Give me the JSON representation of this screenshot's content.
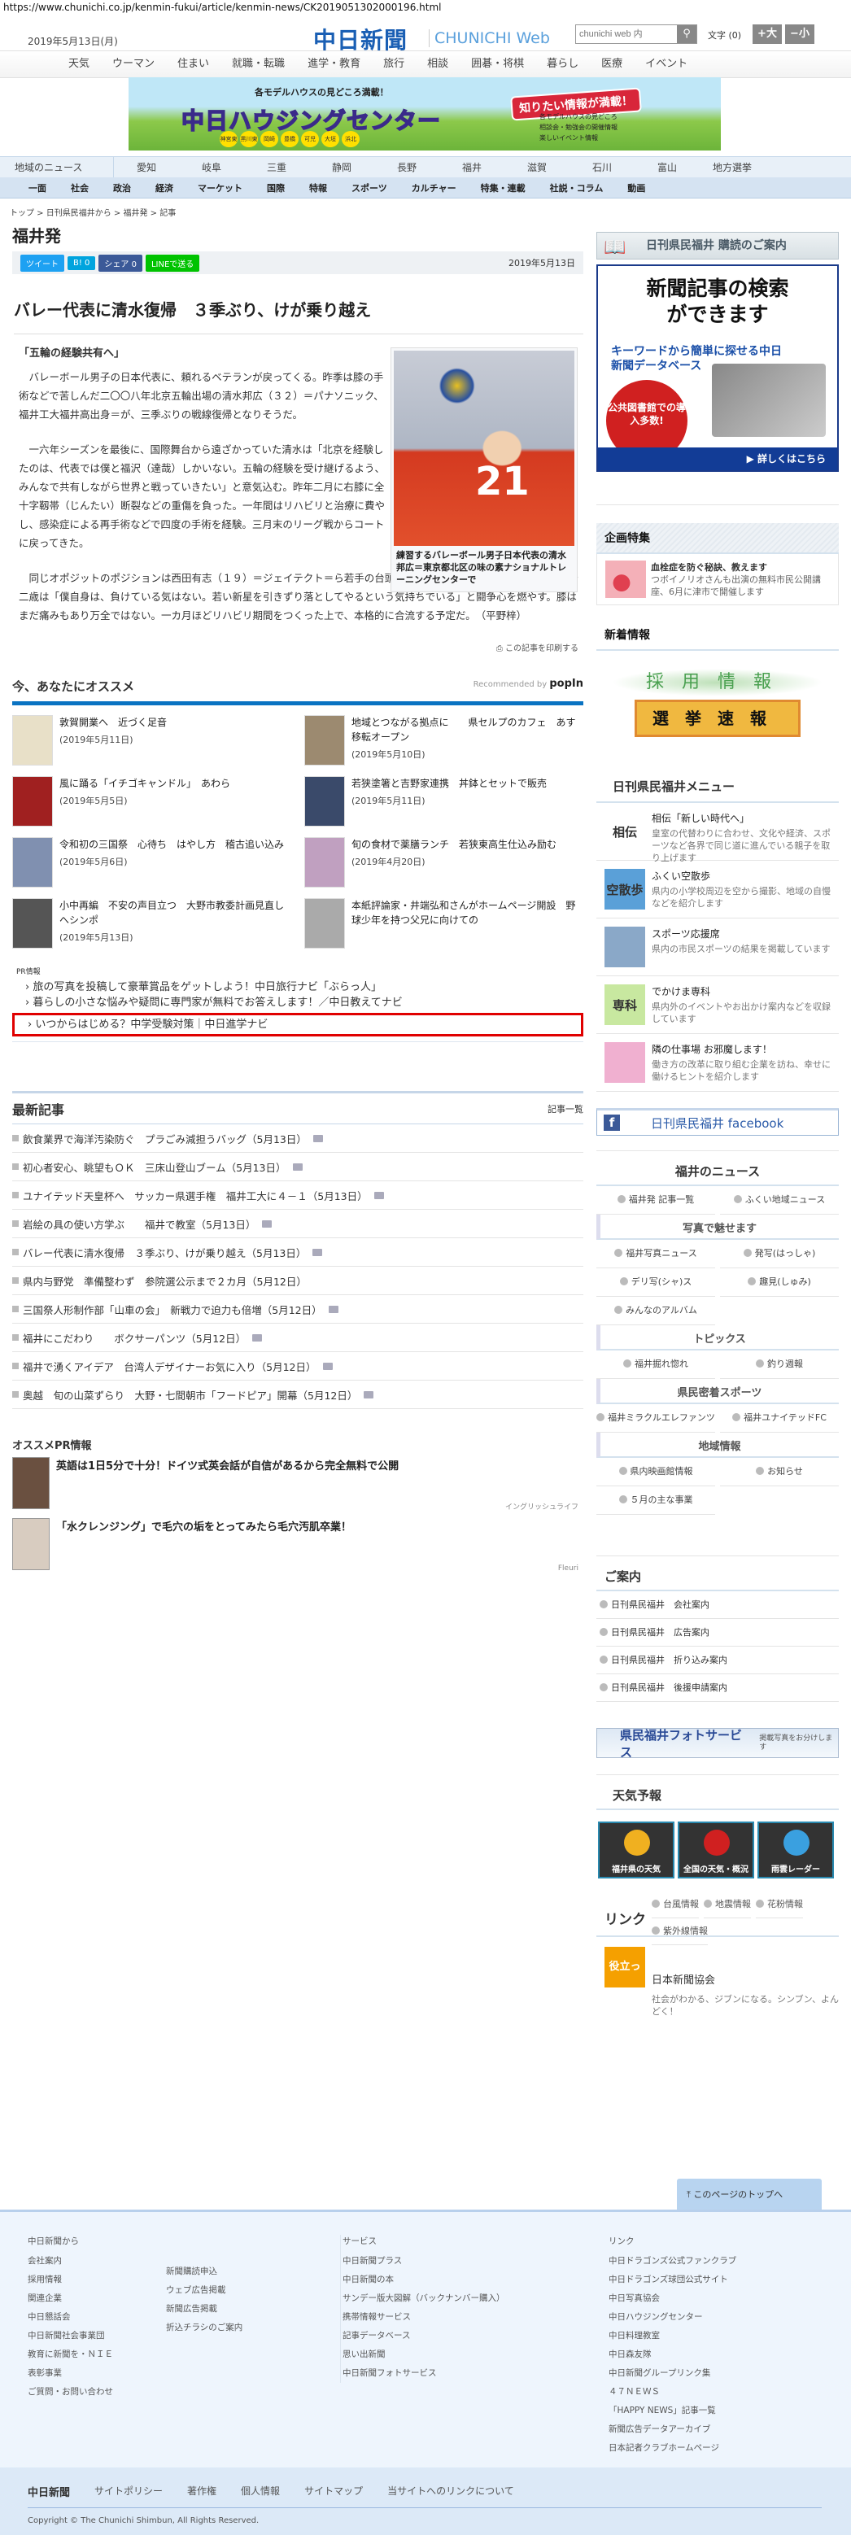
{
  "browser": {
    "url": "https://www.chunichi.co.jp/kenmin-fukui/article/kenmin-news/CK2019051302000196.html"
  },
  "header": {
    "date": "2019年5月13日(月)",
    "logo": "中日新聞",
    "logo_sub": "CHUNICHI Web",
    "search_placeholder": "chunichi web 内",
    "search_icon": "search-icon",
    "font_label": "文字 (0)",
    "font_larger": "+大",
    "font_smaller": "−小"
  },
  "top_nav": [
    "天気",
    "ウーマン",
    "住まい",
    "就職・転職",
    "進学・教育",
    "旅行",
    "相談",
    "囲碁・将棋",
    "暮らし",
    "医療",
    "イベント"
  ],
  "banner": {
    "tagline": "各モデルハウスの見どころ満載！",
    "title": "中日ハウジングセンター",
    "callout": "知りたい情報が満載！",
    "bullets": [
      "各モデルハウスの見どころ",
      "相談会・勉強会の開催情報",
      "楽しいイベント情報"
    ],
    "locations": [
      "神宮東",
      "黒川東",
      "岡崎",
      "豊橋",
      "可児",
      "大垣",
      "浜北"
    ]
  },
  "region_nav": {
    "label": "地域のニュース",
    "items": [
      "愛知",
      "岐阜",
      "三重",
      "静岡",
      "長野",
      "福井",
      "滋賀",
      "石川",
      "富山",
      "地方選挙"
    ]
  },
  "category_nav": [
    "一面",
    "社会",
    "政治",
    "経済",
    "マーケット",
    "国際",
    "特報",
    "スポーツ",
    "カルチャー",
    "特集・連載",
    "社説・コラム",
    "動画"
  ],
  "breadcrumb": [
    "トップ",
    "日刊県民福井から",
    "福井発",
    "記事"
  ],
  "section_title": "福井発",
  "share": {
    "tweet": "ツイート",
    "hatena": "B! 0",
    "facebook": "シェア 0",
    "line": "LINEで送る",
    "date": "2019年5月13日",
    "colors": {
      "twitter": "#1da1f2",
      "hatena": "#00a4de",
      "facebook": "#3b5998",
      "line": "#00c300"
    }
  },
  "article": {
    "headline": "バレー代表に清水復帰　３季ぶり、けが乗り越え",
    "subheading": "「五輪の経験共有へ」",
    "paragraphs": [
      "バレーボール男子の日本代表に、頼れるベテランが戻ってくる。昨季は膝の手術などで苦しんだ二〇〇八年北京五輪出場の清水邦広（３２）＝パナソニック、福井工大福井高出身＝が、三季ぶりの戦線復帰となりそうだ。",
      "一六年シーズンを最後に、国際舞台から遠ざかっていた清水は「北京を経験したのは、代表では僕と福沢（達哉）しかいない。五輪の経験を受け継げるよう、みんなで共有しながら世界と戦っていきたい」と意気込む。昨年二月に右膝に全十字靱帯（じんたい）断裂などの重傷を負った。一年間はリハビリと治療に費やし、感染症による再手術などで四度の手術を経験。三月末のリーグ戦からコートに戻ってきた。",
      "同じオポジットのポジションは西田有志（１９）＝ジェイテクト＝ら若手の台頭が著しい。“ゴリ”の愛称で知られる三十二歳は「僕自身は、負けている気はない。若い新星を引きずり落としてやるという気持ちでいる」と闘争心を燃やす。膝はまだ痛みもあり万全ではない。一カ月ほどリハビリ期間をつくった上で、本格的に合流する予定だ。　（平野梓）"
    ],
    "photo_number": "21",
    "caption": "練習するバレーボール男子日本代表の清水邦広＝東京都北区の味の素ナショナルトレーニングセンターで",
    "print": "この記事を印刷する"
  },
  "recommend": {
    "title": "今、あなたにオススメ",
    "by": "Recommended by",
    "brand": "popIn",
    "items": [
      {
        "title": "敦賀開業へ　近づく足音",
        "date": "(2019年5月11日)"
      },
      {
        "title": "地域とつながる拠点に　　県セルプのカフェ　あす移転オープン",
        "date": "(2019年5月10日)"
      },
      {
        "title": "風に踊る「イチゴキャンドル」　あわら",
        "date": "(2019年5月5日)"
      },
      {
        "title": "若狭塗箸と吉野家連携　丼鉢とセットで販売",
        "date": "(2019年5月11日)"
      },
      {
        "title": "令和初の三国祭　心待ち　はやし方　稽古追い込み",
        "date": "(2019年5月6日)"
      },
      {
        "title": "旬の食材で薬膳ランチ　若狭東高生仕込み励む",
        "date": "(2019年4月20日)"
      },
      {
        "title": "小中再編　不安の声目立つ　大野市教委計画見直しへシンポ",
        "date": "(2019年5月13日)"
      },
      {
        "title": "本紙評論家・井端弘和さんがホームページ開設　野球少年を持つ父兄に向けての",
        "date": ""
      }
    ]
  },
  "pr_info": {
    "label": "PR情報",
    "items": [
      "旅の写真を投稿して豪華賞品をゲットしよう！中日旅行ナビ「ぶらっ人」",
      "暮らしの小さな悩みや疑問に専門家が無料でお答えします！／中日教えてナビ",
      "いつからはじめる？中学受験対策｜中日進学ナビ"
    ]
  },
  "latest": {
    "title": "最新記事",
    "more": "記事一覧",
    "items": [
      {
        "t": "飲食業界で海洋汚染防ぐ　プラごみ減担うバッグ（5月13日）",
        "photo": true
      },
      {
        "t": "初心者安心、眺望もＯＫ　三床山登山ブーム（5月13日）",
        "photo": true
      },
      {
        "t": "ユナイテッド天皇杯へ　サッカー県選手権　福井工大に４－１（5月13日）",
        "photo": true
      },
      {
        "t": "岩絵の具の使い方学ぶ　　福井で教室（5月13日）",
        "photo": true
      },
      {
        "t": "バレー代表に清水復帰　３季ぶり、けが乗り越え（5月13日）",
        "photo": true
      },
      {
        "t": "県内与野党　準備整わず　参院選公示まで２カ月（5月12日）",
        "photo": false
      },
      {
        "t": "三国祭人形制作部「山車の会」　新戦力で迫力も倍増（5月12日）",
        "photo": true
      },
      {
        "t": "福井にこだわり　　ボクサーパンツ（5月12日）",
        "photo": true
      },
      {
        "t": "福井で湧くアイデア　台湾人デザイナーお気に入り（5月12日）",
        "photo": true
      },
      {
        "t": "奥越　旬の山菜ずらり　大野・七間朝市「フードピア」開幕（5月12日）",
        "photo": true
      }
    ]
  },
  "ospr": {
    "title": "オススメPR情報",
    "items": [
      {
        "t": "英語は1日5分で十分！ドイツ式英会話が自信があるから完全無料で公開",
        "src": "イングリッシュライフ"
      },
      {
        "t": "「水クレンジング」で毛穴の垢をとってみたら毛穴汚肌卒業！",
        "src": "Fleuri"
      }
    ]
  },
  "sidebar": {
    "subscribe": "日刊県民福井 購読のご案内",
    "db_ad": {
      "headline": "新聞記事の検索ができます",
      "sub": "キーワードから簡単に探せる中日新聞データベース",
      "circle": "公共図書館での導入多数!",
      "cta": "▶ 詳しくはこちら"
    },
    "kikaku": {
      "title": "企画特集",
      "item_title": "血栓症を防ぐ秘訣、教えます",
      "item_desc": "つボイノリオさんも出演の無料市民公開講座、6月に津市で開催します"
    },
    "shinchaku": {
      "title": "新着情報",
      "saiyo": "採用情報",
      "senkyo": "選挙速報"
    },
    "menu": {
      "title": "日刊県民福井メニュー",
      "items": [
        {
          "thumb": "相伝",
          "t": "相伝「新しい時代へ」",
          "d": "皇室の代替わりに合わせ、文化や経済、スポーツなど各界で同じ道に進んでいる親子を取り上げます"
        },
        {
          "thumb": "空散歩",
          "t": "ふくい空散歩",
          "d": "県内の小学校周辺を空から撮影、地域の自慢などを紹介します"
        },
        {
          "thumb": "",
          "t": "スポーツ応援席",
          "d": "県内の市民スポーツの結果を掲載しています"
        },
        {
          "thumb": "専科",
          "t": "でかけま専科",
          "d": "県内外のイベントやお出かけ案内などを収録しています"
        },
        {
          "thumb": "",
          "t": "隣の仕事場 お邪魔します！",
          "d": "働き方の改革に取り組む企業を訪ね、幸せに働けるヒントを紹介します"
        }
      ]
    },
    "facebook": "日刊県民福井 facebook",
    "fukui_news": {
      "title": "福井のニュース",
      "top": [
        "福井発 記事一覧",
        "ふくい地域ニュース"
      ],
      "groups": [
        {
          "h": "写真で魅せます",
          "items": [
            "福井写真ニュース",
            "発写(はっしゃ)",
            "デリ写(シャ)ス",
            "趣見(しゅみ)",
            "みんなのアルバム"
          ]
        },
        {
          "h": "トピックス",
          "items": [
            "福井掘れ惚れ",
            "釣り週報"
          ]
        },
        {
          "h": "県民密着スポーツ",
          "items": [
            "福井ミラクルエレファンツ",
            "福井ユナイテッドFC"
          ]
        },
        {
          "h": "地域情報",
          "items": [
            "県内映画館情報",
            "お知らせ",
            "５月の主な事業"
          ]
        }
      ]
    },
    "guide": {
      "title": "ご案内",
      "items": [
        "日刊県民福井　会社案内",
        "日刊県民福井　広告案内",
        "日刊県民福井　折り込み案内",
        "日刊県民福井　後援申請案内"
      ]
    },
    "photo_service": {
      "title": "県民福井フォトサービス",
      "sub": "掲載写真をお分けします"
    },
    "weather": {
      "title": "天気予報",
      "tiles": [
        "福井県の天気",
        "全国の天気・概況",
        "雨雲レーダー"
      ]
    },
    "links": {
      "title": "リンク",
      "items": [
        "台風情報",
        "地震情報",
        "花粉情報",
        "紫外線情報"
      ]
    },
    "nsk": {
      "thumb": "役立った",
      "title": "日本新聞協会",
      "desc": "社会がわかる、ジブンになる。シンブン、よんどく！"
    }
  },
  "to_top": "このページのトップへ",
  "footer": {
    "col1": {
      "title": "中日新聞から",
      "a": [
        "会社案内",
        "採用情報",
        "関連企業",
        "中日懇話会",
        "中日新聞社会事業団",
        "教育に新聞を・ＮＩＥ",
        "表彰事業",
        "ご質問・お問い合わせ"
      ],
      "b": [
        "新聞購読申込",
        "ウェブ広告掲載",
        "新聞広告掲載",
        "折込チラシのご案内"
      ]
    },
    "col2": {
      "title": "サービス",
      "items": [
        "中日新聞プラス",
        "中日新聞の本",
        "サンデー版大図解（バックナンバー購入）",
        "携帯情報サービス",
        "記事データベース",
        "思い出新聞",
        "中日新聞フォトサービス"
      ]
    },
    "col3": {
      "title": "リンク",
      "items": [
        "中日ドラゴンズ公式ファンクラブ",
        "中日ドラゴンズ球団公式サイト",
        "中日写真協会",
        "中日ハウジングセンター",
        "中日料理教室",
        "中日森友隊",
        "中日新聞グループリンク集",
        "４７ＮＥＷＳ",
        "「HAPPY NEWS」記事一覧",
        "新聞広告データアーカイブ",
        "日本記者クラブホームページ"
      ]
    },
    "bottom_logo": "中日新聞",
    "bottom_links": [
      "サイトポリシー",
      "著作権",
      "個人情報",
      "サイトマップ",
      "当サイトへのリンクについて"
    ],
    "copyright": "Copyright © The Chunichi Shimbun, All Rights Reserved."
  }
}
